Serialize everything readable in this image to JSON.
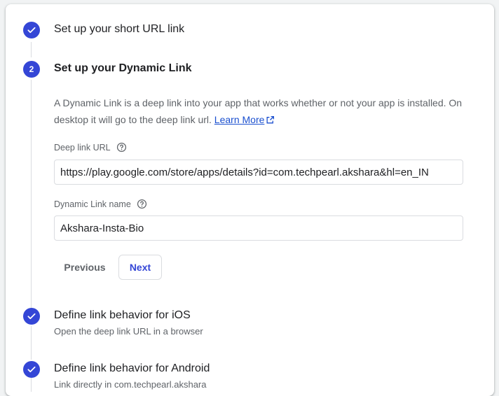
{
  "steps": [
    {
      "status": "done",
      "title": "Set up your short URL link"
    },
    {
      "status": "active",
      "number": "2",
      "title": "Set up your Dynamic Link"
    },
    {
      "status": "done",
      "title": "Define link behavior for iOS",
      "subtitle": "Open the deep link URL in a browser"
    },
    {
      "status": "done",
      "title": "Define link behavior for Android",
      "subtitle": "Link directly in com.techpearl.akshara"
    }
  ],
  "description": {
    "text": "A Dynamic Link is a deep link into your app that works whether or not your app is installed. On desktop it will go to the deep link url.",
    "learn_more": "Learn More",
    "learn_more_icon": "open-in-new-icon"
  },
  "deep_link": {
    "label": "Deep link URL",
    "help_icon": "help-icon",
    "value": "https://play.google.com/store/apps/details?id=com.techpearl.akshara&hl=en_IN"
  },
  "link_name": {
    "label": "Dynamic Link name",
    "help_icon": "help-icon",
    "value": "Akshara-Insta-Bio"
  },
  "actions": {
    "previous": "Previous",
    "next": "Next"
  },
  "colors": {
    "accent": "#3446d6",
    "link": "#1a4fcf",
    "muted_text": "#5f6368"
  }
}
